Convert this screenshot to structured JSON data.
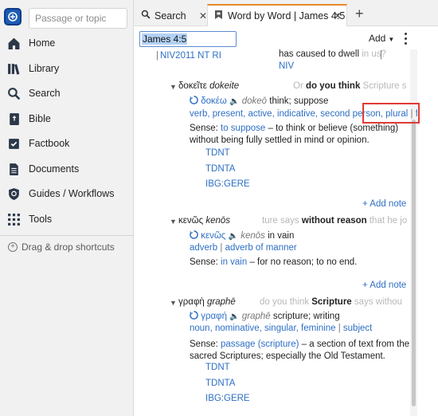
{
  "sidebar": {
    "search_placeholder": "Passage or topic",
    "items": [
      {
        "label": "Home",
        "icon": "home-icon"
      },
      {
        "label": "Library",
        "icon": "library-icon"
      },
      {
        "label": "Search",
        "icon": "search-icon"
      },
      {
        "label": "Bible",
        "icon": "bible-icon"
      },
      {
        "label": "Factbook",
        "icon": "factbook-icon"
      },
      {
        "label": "Documents",
        "icon": "documents-icon"
      },
      {
        "label": "Guides / Workflows",
        "icon": "guides-icon"
      },
      {
        "label": "Tools",
        "icon": "tools-icon"
      }
    ],
    "drag_label": "Drag & drop shortcuts"
  },
  "tabs": [
    {
      "label": "Search",
      "icon": "search-icon"
    },
    {
      "label": "Word by Word | James 4:5",
      "icon": "word-by-word-icon",
      "active": true
    }
  ],
  "panel": {
    "reference": "James 4:5",
    "add_label": "Add"
  },
  "top": {
    "version_link": "NIV2011 NT RI",
    "sep": "|",
    "verse_text": "has caused to dwell",
    "verse_faded": "in us?",
    "niv_link": "NIV"
  },
  "entries": [
    {
      "greek": "δοκεῖτε",
      "translit": "dokeite",
      "context_pre": "Or",
      "context_bold": "do you think",
      "context_post": "Scripture s",
      "lemma": "δοκέω",
      "lemma_translit": "dokeō",
      "gloss": "think; suppose",
      "morph_line": [
        "verb",
        "present",
        "active",
        "indicative",
        "second person",
        "plural",
        "fin"
      ],
      "sense_label": "Sense:",
      "sense_link": "to suppose",
      "sense_text_1": "– to think or believe (something)",
      "sense_text_2": "without being fully settled in mind or opinion.",
      "refs": [
        "TDNT",
        "TDNTA",
        "IBG:GERE"
      ],
      "add_note": "+ Add note"
    },
    {
      "greek": "κενῶς",
      "translit": "kenōs",
      "context_pre": "ture says",
      "context_bold": "without reason",
      "context_post": "that he jo",
      "lemma": "κενῶς",
      "lemma_translit": "kenōs",
      "gloss": "in vain",
      "morph_line": [
        "adverb",
        "adverb of manner"
      ],
      "sense_label": "Sense:",
      "sense_link": "in vain",
      "sense_text_1": "– for no reason; to no end.",
      "add_note": "+ Add note"
    },
    {
      "greek": "γραφὴ",
      "translit": "graphē",
      "context_pre": "do you think",
      "context_bold": "Scripture",
      "context_post": "says withou",
      "lemma": "γραφή",
      "lemma_translit": "graphē",
      "gloss": "scripture; writing",
      "morph_line": [
        "noun",
        "nominative",
        "singular",
        "feminine",
        "subject"
      ],
      "sense_label": "Sense:",
      "sense_link": "passage (scripture)",
      "sense_text_1": "– a section of text from the",
      "sense_text_2": "sacred Scriptures; especially the Old Testament.",
      "refs": [
        "TDNT",
        "TDNTA",
        "IBG:GERE"
      ]
    }
  ],
  "colors": {
    "accent_tab": "#e58a2c",
    "link": "#2e6fc4",
    "highlight_box": "#e03a36",
    "logo": "#1d5cb4"
  }
}
